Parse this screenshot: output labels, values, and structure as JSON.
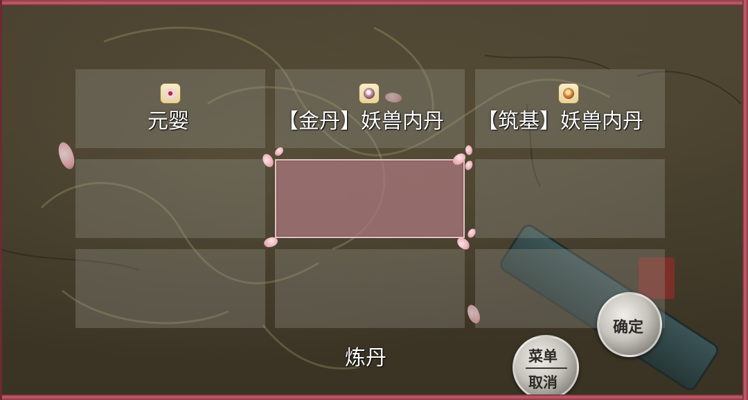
{
  "screen": {
    "title": "炼丹"
  },
  "grid": {
    "cells": [
      {
        "icon": "red-eye-pill-icon",
        "label": "元婴"
      },
      {
        "icon": "gold-core-icon",
        "label": "【金丹】妖兽内丹"
      },
      {
        "icon": "foundation-core-icon",
        "label": "【筑基】妖兽内丹"
      },
      {
        "icon": "",
        "label": ""
      },
      {
        "icon": "",
        "label": ""
      },
      {
        "icon": "",
        "label": ""
      },
      {
        "icon": "",
        "label": ""
      },
      {
        "icon": "",
        "label": ""
      },
      {
        "icon": "",
        "label": ""
      }
    ],
    "selected_index": 4
  },
  "buttons": {
    "confirm": "确定",
    "menu_line1": "菜单",
    "menu_line2": "取消"
  },
  "colors": {
    "frame": "#c4606c",
    "selected_cell": "#aa787d"
  }
}
